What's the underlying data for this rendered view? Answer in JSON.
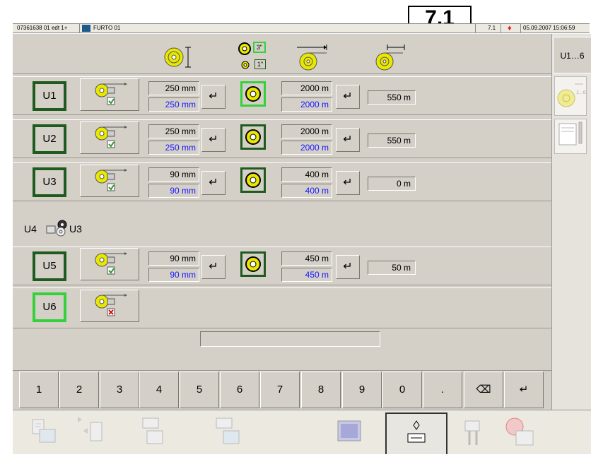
{
  "header": {
    "screen_number": "7.1",
    "program_id": "07361638 01 edt 1+",
    "machine_name": "FURTO 01",
    "page_code": "7.1",
    "datetime": "05.09.2007 15:06:59"
  },
  "side_tab": {
    "label": "U1…6"
  },
  "column_headers": {
    "core_label_3in": "3\"",
    "core_label_1in": "1\""
  },
  "units": [
    {
      "label": "U1",
      "diameter": "250 mm",
      "diameter_set": "250 mm",
      "length": "2000 m",
      "length_set": "2000 m",
      "result": "550 m",
      "active": false,
      "reel_active": true,
      "enabled": true
    },
    {
      "label": "U2",
      "diameter": "250 mm",
      "diameter_set": "250 mm",
      "length": "2000 m",
      "length_set": "2000 m",
      "result": "550 m",
      "active": false,
      "reel_active": false,
      "enabled": true
    },
    {
      "label": "U3",
      "diameter": "90 mm",
      "diameter_set": "90 mm",
      "length": "400 m",
      "length_set": "400 m",
      "result": "0 m",
      "active": false,
      "reel_active": false,
      "enabled": true
    }
  ],
  "link": {
    "from": "U4",
    "to": "U3"
  },
  "unit5": {
    "label": "U5",
    "diameter": "90 mm",
    "diameter_set": "90 mm",
    "length": "450 m",
    "length_set": "450 m",
    "result": "50 m",
    "reel_active": false,
    "enabled": true
  },
  "unit6": {
    "label": "U6",
    "active": true,
    "enabled": false
  },
  "enter_symbol": "↵",
  "keypad": [
    "1",
    "2",
    "3",
    "4",
    "5",
    "6",
    "7",
    "8",
    "9",
    "0",
    ".",
    "⌫",
    "↵"
  ],
  "colors": {
    "active_border": "#35d13a",
    "normal_border": "#1f5a1f",
    "set_value": "#1a1aff",
    "panel": "#d4d0c8"
  }
}
